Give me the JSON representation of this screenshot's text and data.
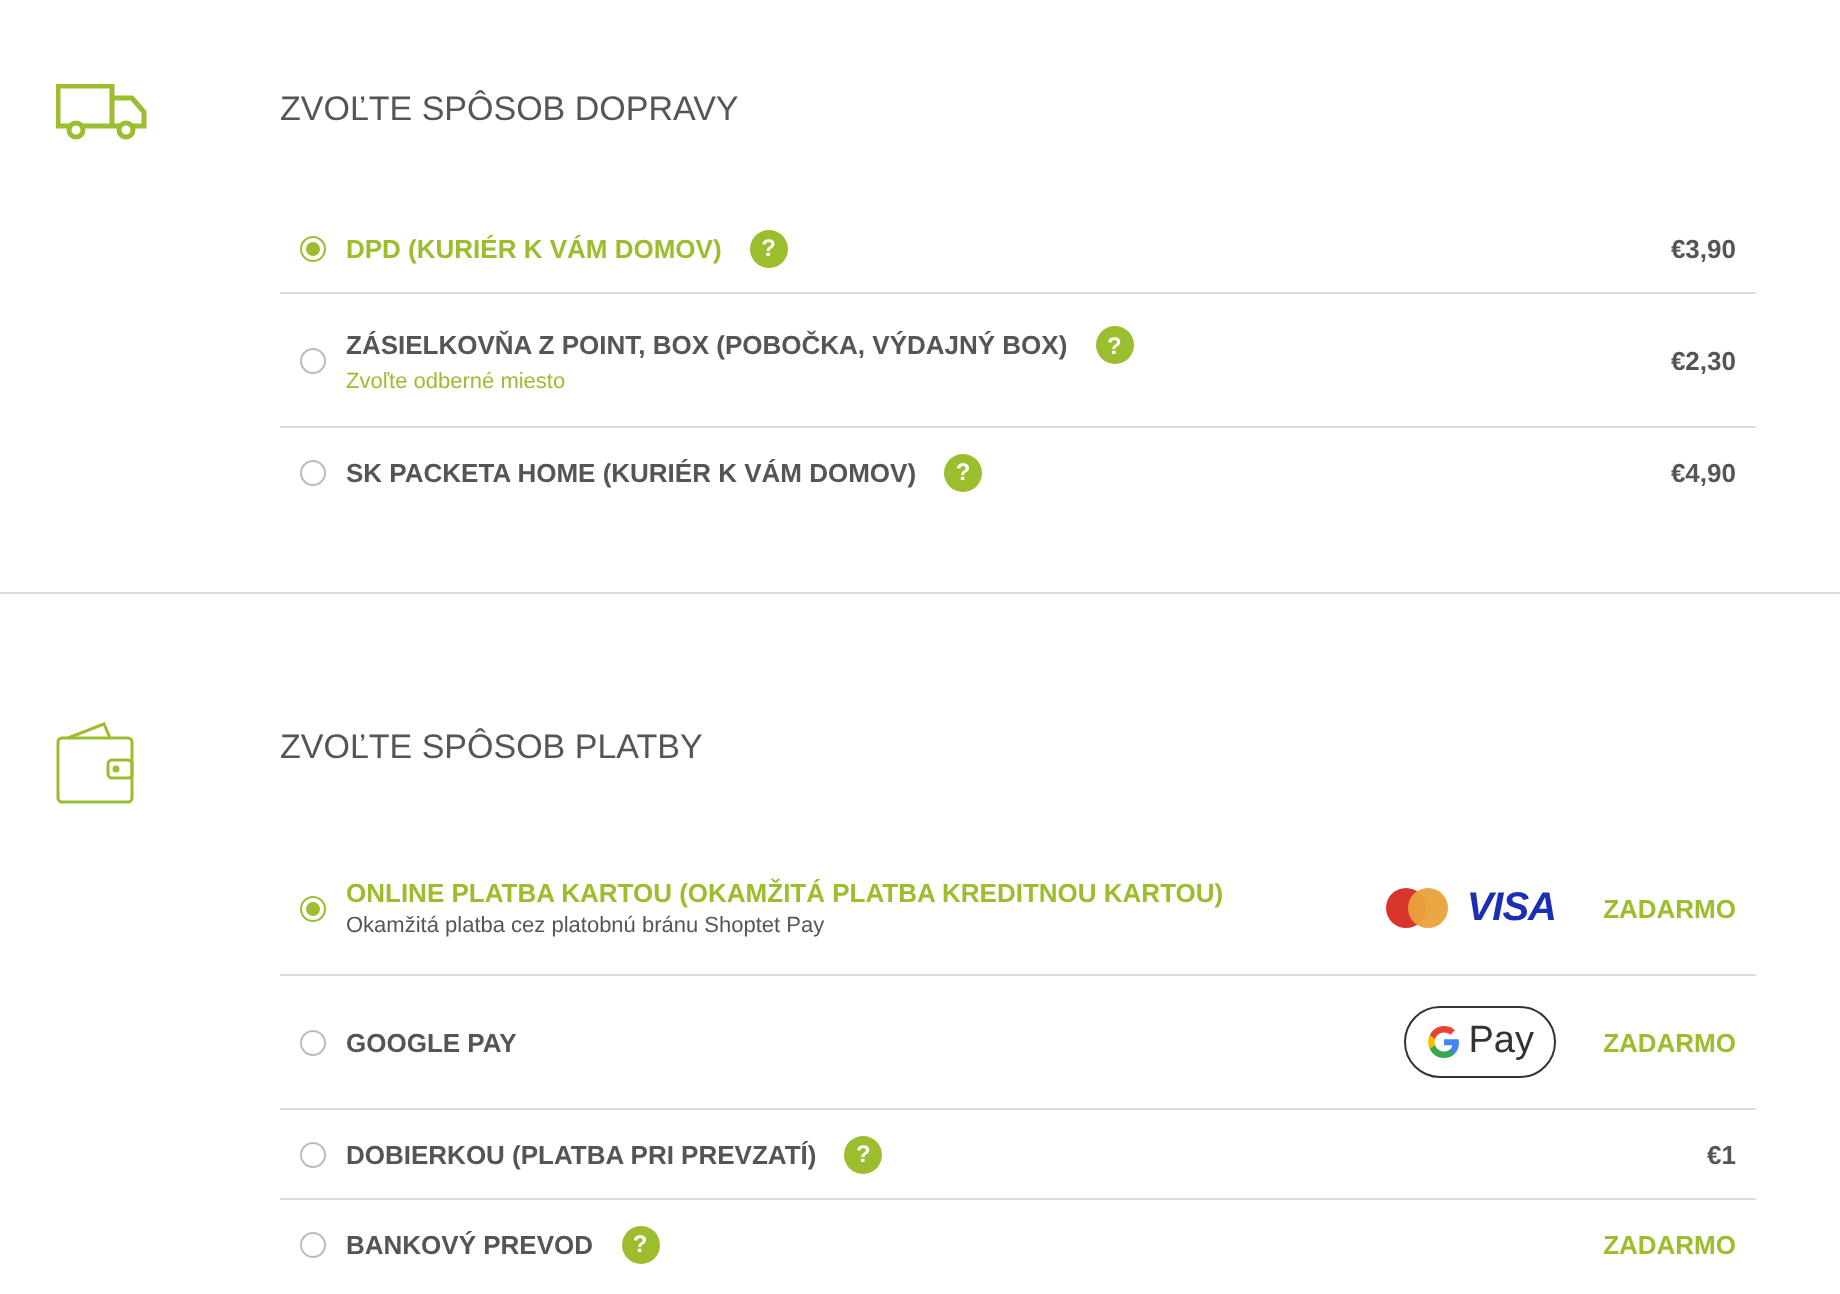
{
  "sections": [
    {
      "kind": "shipping",
      "title": "ZVOĽTE SPÔSOB DOPRAVY",
      "options": [
        {
          "label": "DPD (KURIÉR K VÁM DOMOV)",
          "selected": true,
          "help": "?",
          "price": "€3,90",
          "free": false
        },
        {
          "label": "ZÁSIELKOVŇA Z POINT, BOX (POBOČKA, VÝDAJNÝ BOX)",
          "selected": false,
          "help": "?",
          "note": "Zvoľte odberné miesto",
          "note_link": true,
          "price": "€2,30",
          "free": false
        },
        {
          "label": "SK PACKETA HOME (KURIÉR K VÁM DOMOV)",
          "selected": false,
          "help": "?",
          "price": "€4,90",
          "free": false
        }
      ]
    },
    {
      "kind": "payment",
      "title": "ZVOĽTE SPÔSOB PLATBY",
      "options": [
        {
          "label": "ONLINE PLATBA KARTOU (OKAMŽITÁ PLATBA KREDITNOU KARTOU)",
          "selected": true,
          "note": "Okamžitá platba cez platobnú bránu Shoptet Pay",
          "note_link": false,
          "logo": {
            "kind": "cards",
            "text": "VISA"
          },
          "price": "ZADARMO",
          "free": true
        },
        {
          "label": "GOOGLE PAY",
          "selected": false,
          "logo": {
            "kind": "gpay",
            "text": "Pay"
          },
          "price": "ZADARMO",
          "free": true
        },
        {
          "label": "DOBIERKOU (PLATBA PRI PREVZATÍ)",
          "selected": false,
          "help": "?",
          "price": "€1",
          "free": false
        },
        {
          "label": "BANKOVÝ PREVOD",
          "selected": false,
          "help": "?",
          "price": "ZADARMO",
          "free": true
        }
      ]
    }
  ]
}
